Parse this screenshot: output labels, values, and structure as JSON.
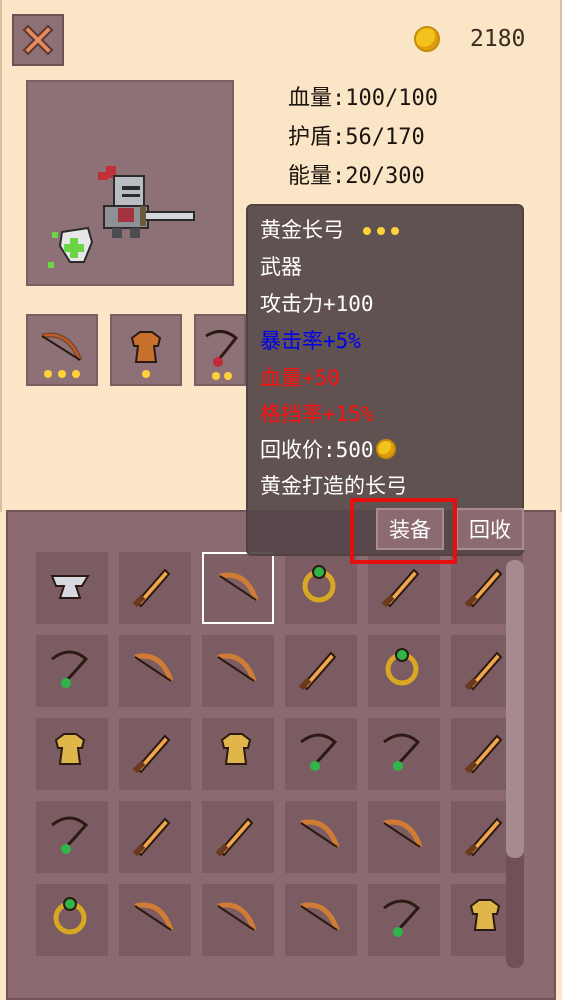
{
  "header": {
    "coins": "2180"
  },
  "stats": [
    {
      "label": "血量:100/100"
    },
    {
      "label": "护盾:56/170"
    },
    {
      "label": "能量:20/300"
    }
  ],
  "tooltip": {
    "name": "黄金长弓",
    "category": "武器",
    "attack": "攻击力+100",
    "crit": "暴击率+5%",
    "hp": "血量+50",
    "block": "格挡率+15%",
    "recycle_value": "回收价:500",
    "description": "黄金打造的长弓",
    "equip_label": "装备",
    "recycle_label": "回收",
    "colors": {
      "crit": "#0000ee",
      "hp": "#ff1010",
      "block": "#ff1010"
    }
  },
  "equipped": [
    "bow-icon",
    "armor-icon",
    "necklace-icon"
  ],
  "inventory": [
    [
      "anvil-armor-icon",
      "sword-icon",
      "bow-icon",
      "ring-icon",
      "sword-icon",
      "sword-icon"
    ],
    [
      "necklace-icon",
      "bow-icon",
      "bow-icon",
      "sword-icon",
      "ring-icon",
      "sword-icon"
    ],
    [
      "armor-icon",
      "sword-icon",
      "armor-icon",
      "necklace-icon",
      "necklace-icon",
      "sword-icon"
    ],
    [
      "necklace-icon",
      "sword-icon",
      "sword-icon",
      "bow-icon",
      "bow-icon",
      "sword-icon"
    ],
    [
      "ring-icon",
      "bow-icon",
      "bow-icon",
      "bow-icon",
      "necklace-icon",
      "armor-icon"
    ]
  ]
}
